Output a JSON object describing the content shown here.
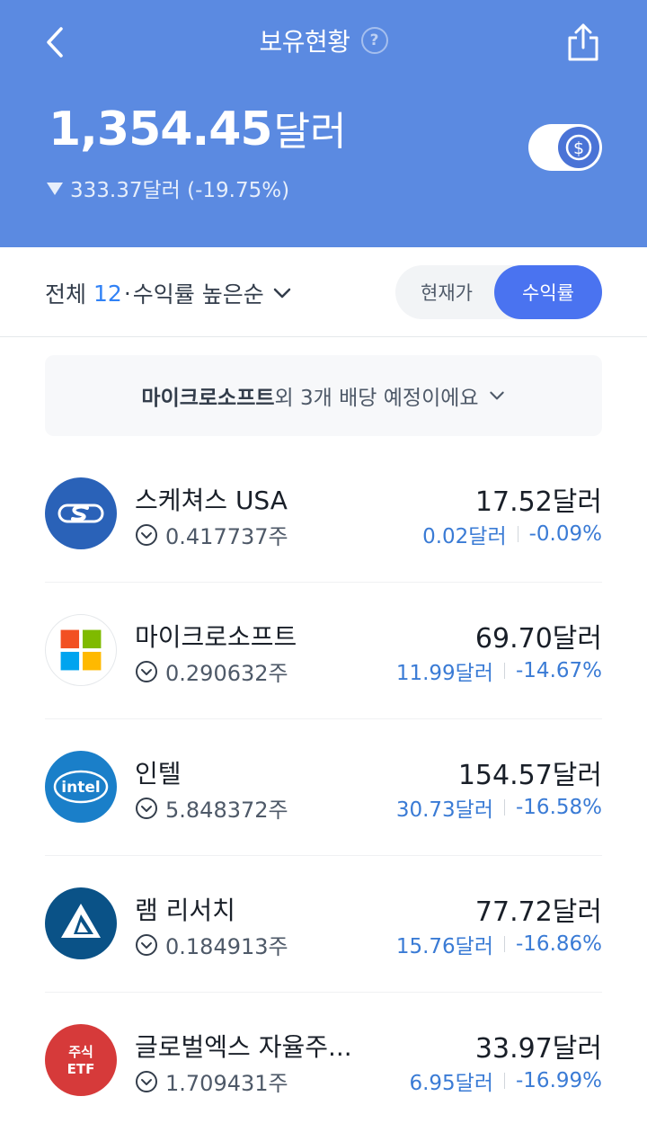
{
  "header": {
    "title": "보유현황",
    "help": "?",
    "total_amount": "1,354.45",
    "total_unit": "달러",
    "change_text": "333.37달러 (-19.75%)",
    "currency_symbol": "$"
  },
  "filter": {
    "all_label": "전체",
    "count": "12",
    "separator": "·",
    "sort_label": "수익률 높은순",
    "toggle_current_price": "현재가",
    "toggle_return_rate": "수익률",
    "selected": "수익률"
  },
  "banner": {
    "company": "마이크로소프트",
    "text": "외 3개 배당 예정이에요"
  },
  "holdings": [
    {
      "name": "스케쳐스 USA",
      "shares": "0.417737주",
      "value": "17.52달러",
      "pl_amount": "0.02달러",
      "pl_rate": "-0.09%",
      "logo": "skechers-logo"
    },
    {
      "name": "마이크로소프트",
      "shares": "0.290632주",
      "value": "69.70달러",
      "pl_amount": "11.99달러",
      "pl_rate": "-14.67%",
      "logo": "microsoft-logo"
    },
    {
      "name": "인텔",
      "shares": "5.848372주",
      "value": "154.57달러",
      "pl_amount": "30.73달러",
      "pl_rate": "-16.58%",
      "logo": "intel-logo",
      "logo_text": "intel"
    },
    {
      "name": "램 리서치",
      "shares": "0.184913주",
      "value": "77.72달러",
      "pl_amount": "15.76달러",
      "pl_rate": "-16.86%",
      "logo": "lam-research-logo"
    },
    {
      "name": "글로벌엑스 자율주...",
      "shares": "1.709431주",
      "value": "33.97달러",
      "pl_amount": "6.95달러",
      "pl_rate": "-16.99%",
      "logo": "etf-logo",
      "logo_text_top": "주식",
      "logo_text_bottom": "ETF"
    }
  ],
  "colors": {
    "header_bg": "#5b8ae1",
    "accent": "#4a73f0",
    "loss_blue": "#3a7bd5"
  }
}
